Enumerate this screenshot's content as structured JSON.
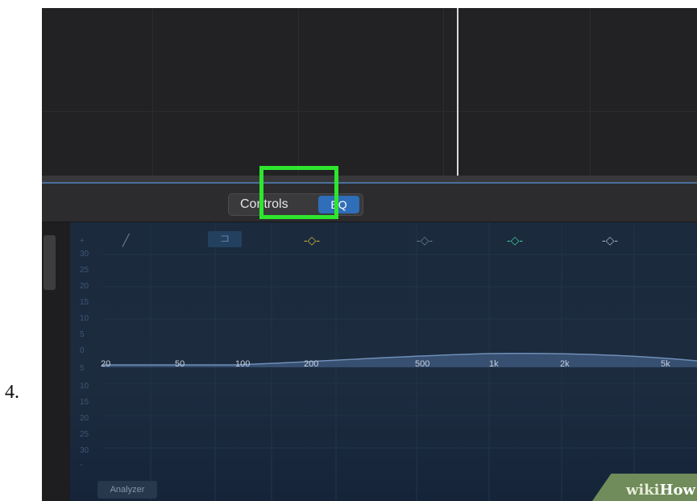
{
  "step": {
    "number": "4."
  },
  "editor": {
    "tabs": [
      {
        "label": "Controls",
        "selected": false
      },
      {
        "label": "EQ",
        "selected": true
      }
    ]
  },
  "eq": {
    "db_scale_top": [
      "+",
      "30",
      "25",
      "20",
      "15",
      "10",
      "5",
      "0"
    ],
    "db_scale_bottom": [
      "5",
      "10",
      "15",
      "20",
      "25",
      "30",
      "-"
    ],
    "frequency_labels": [
      "20",
      "50",
      "100",
      "200",
      "500",
      "1k",
      "2k",
      "5k"
    ],
    "band_icons": [
      {
        "name": "low-cut-icon",
        "glyph": "╱"
      },
      {
        "name": "low-shelf-icon",
        "glyph": "⊐"
      },
      {
        "name": "band-1-icon",
        "glyph": "-◇-"
      },
      {
        "name": "band-2-icon",
        "glyph": "-◇-"
      },
      {
        "name": "band-3-icon",
        "glyph": "-◇-"
      },
      {
        "name": "band-4-icon",
        "glyph": "-◇-"
      }
    ],
    "analyzer_label": "Analyzer"
  },
  "watermark": {
    "wiki": "wiki",
    "how": "How"
  },
  "colors": {
    "highlight": "#2ee62e",
    "eq_selected": "#2f6eb8",
    "eq_background": "#1b2a3d"
  }
}
